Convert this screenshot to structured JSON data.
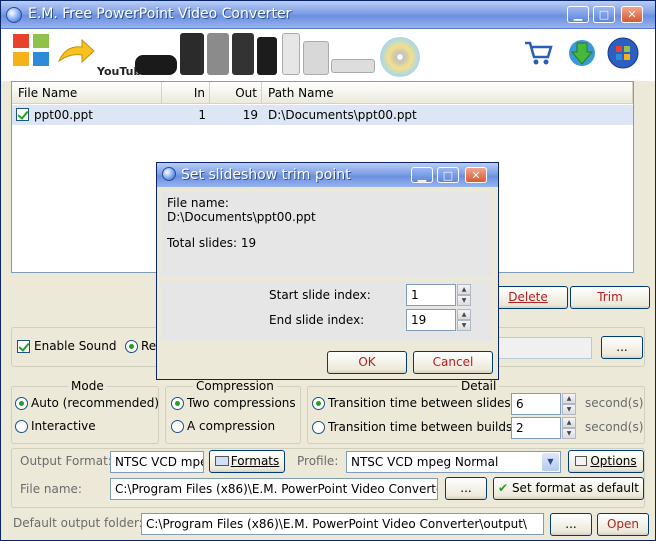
{
  "window": {
    "title": "E.M. Free PowerPoint Video Converter",
    "accent": "#6a8fe0"
  },
  "caption_buttons": {
    "minimize": "▁",
    "maximize": "□",
    "close": "✕"
  },
  "toolbar": {
    "youtube_logo": "YouTube",
    "icons": [
      "office-logo",
      "arrow-icon",
      "devices-banner",
      "cart-icon",
      "download-icon",
      "about-icon"
    ]
  },
  "file_list": {
    "columns": [
      "File Name",
      "In",
      "Out",
      "Path Name"
    ],
    "rows": [
      {
        "name": "ppt00.ppt",
        "in": "1",
        "out": "19",
        "path": "D:\\Documents\\ppt00.ppt"
      }
    ]
  },
  "list_buttons": {
    "delete": "Delete",
    "trim": "Trim"
  },
  "sound": {
    "enable_label": "Enable Sound",
    "re_label": "Re",
    "browse": "..."
  },
  "mode": {
    "title": "Mode",
    "auto": "Auto (recommended)",
    "interactive": "Interactive"
  },
  "compression": {
    "title": "Compression",
    "two": "Two compressions",
    "one": "A compression"
  },
  "detail": {
    "title": "Detail",
    "slides_label": "Transition time between slides",
    "slides_value": "6",
    "builds_label": "Transition time between builds",
    "builds_value": "2",
    "unit": "second(s)"
  },
  "output": {
    "format_label": "Output Format:",
    "format_value": "NTSC VCD mpe",
    "formats_button": "Formats",
    "profile_label": "Profile:",
    "profile_value": "NTSC VCD mpeg Normal",
    "options_button": "Options",
    "filename_label": "File name:",
    "filename_value": "C:\\Program Files (x86)\\E.M. PowerPoint Video Converte",
    "browse": "...",
    "set_default": "Set format as default",
    "folder_label": "Default output folder:",
    "folder_value": "C:\\Program Files (x86)\\E.M. PowerPoint Video Converter\\output\\",
    "open": "Open"
  },
  "dialog": {
    "title": "Set slideshow trim point",
    "file_name_label": "File name:",
    "file_name_value": "D:\\Documents\\ppt00.ppt",
    "total_slides": "Total slides: 19",
    "start_label": "Start slide index:",
    "start_value": "1",
    "end_label": "End slide index:",
    "end_value": "19",
    "ok": "OK",
    "cancel": "Cancel"
  }
}
